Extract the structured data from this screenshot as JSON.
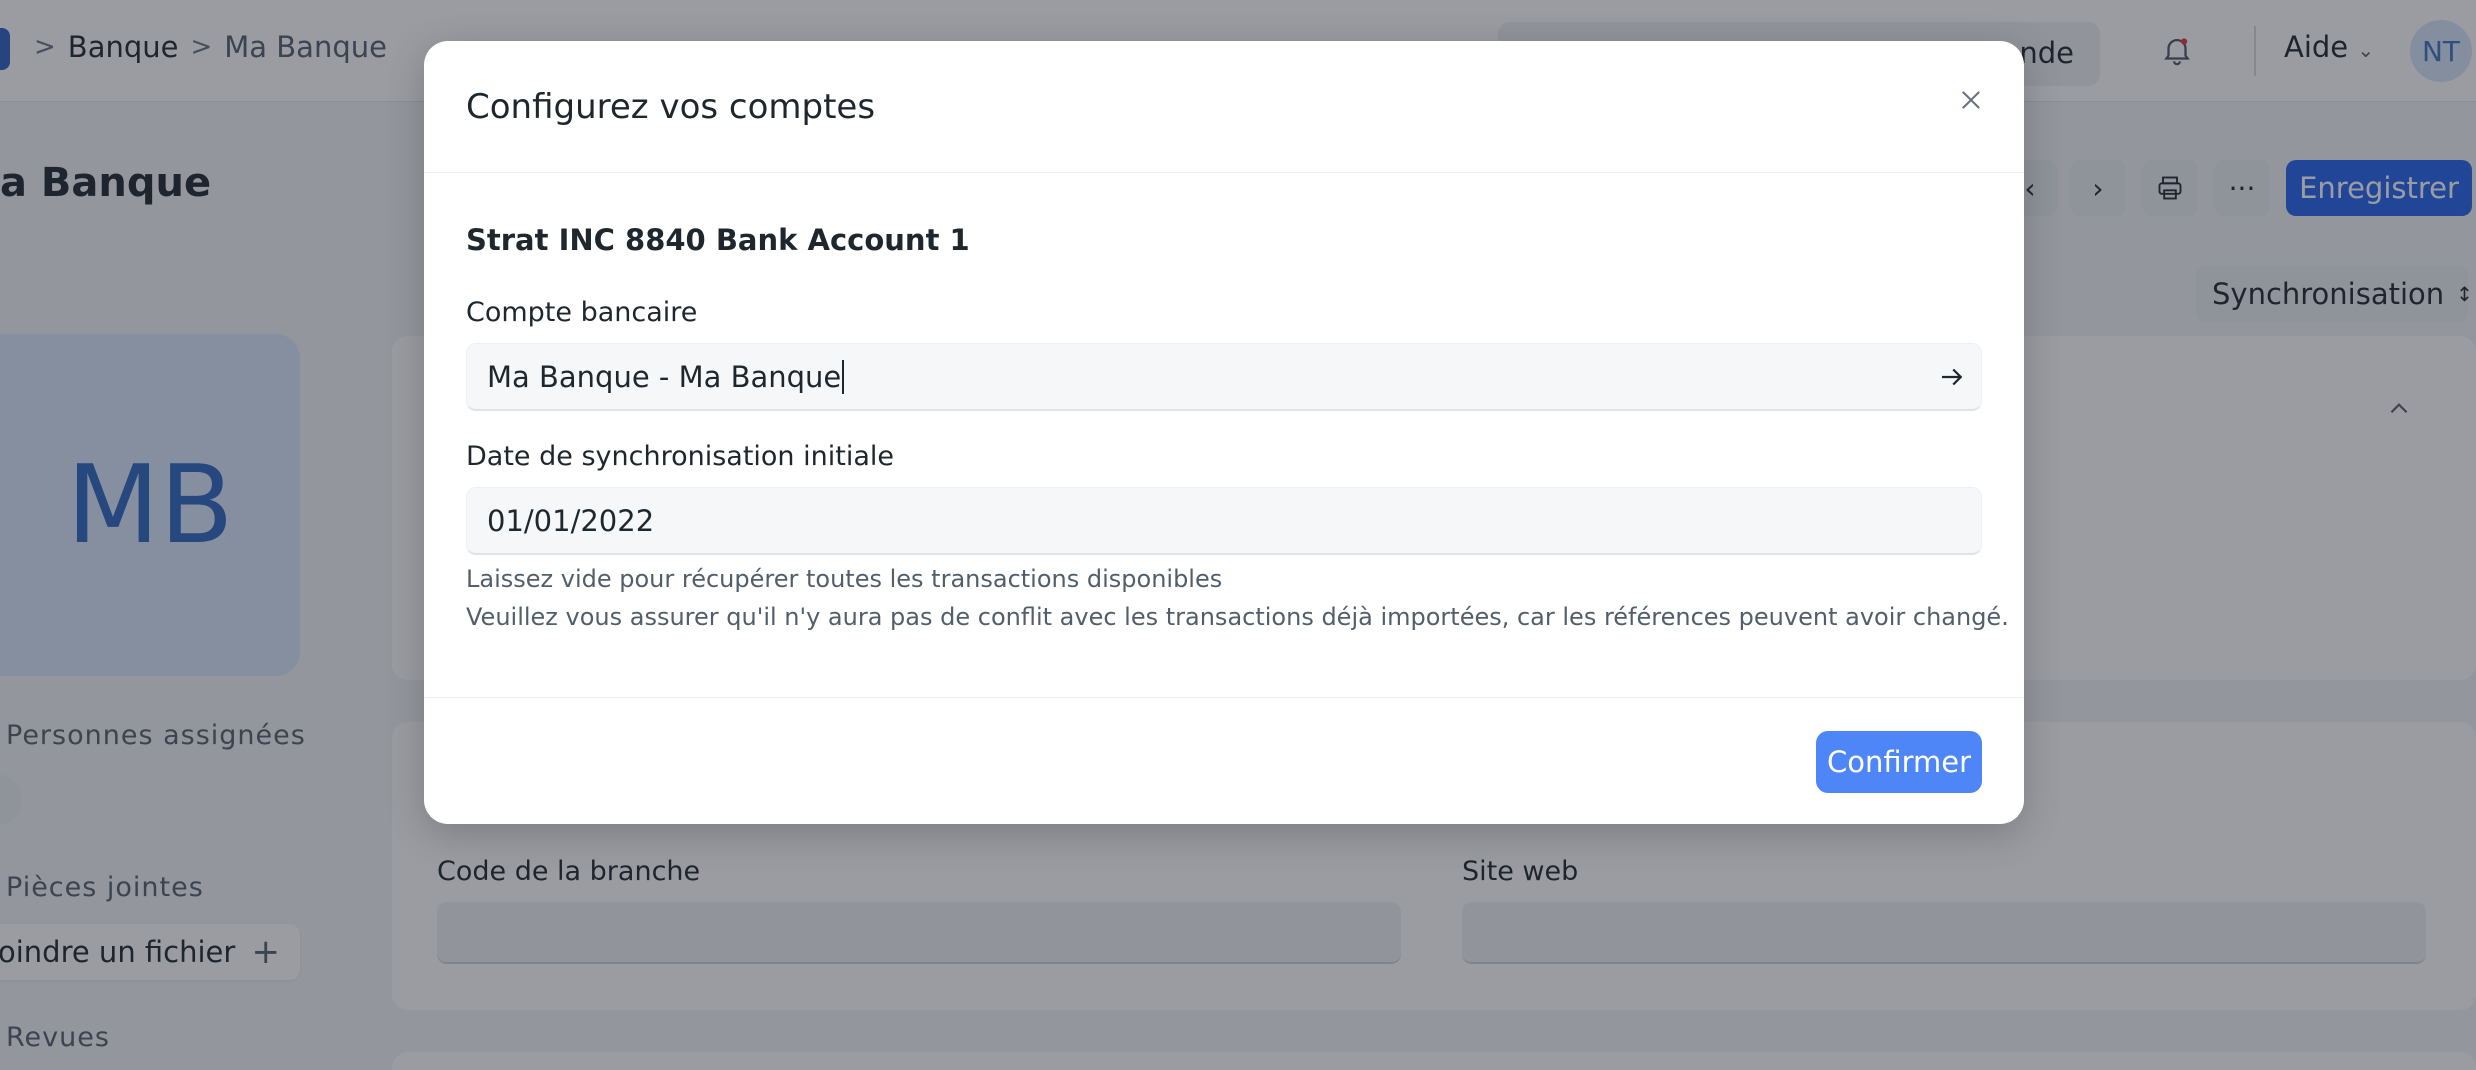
{
  "topbar": {
    "breadcrumb": [
      ">",
      "Banque",
      ">",
      "Ma Banque"
    ],
    "search_tail": "nde",
    "help_label": "Aide",
    "user_initials": "NT"
  },
  "page": {
    "title": "a Banque",
    "save_label": "Enregistrer",
    "more_label": "···",
    "sync_select_value": "Synchronisation",
    "avatar_initials": "MB",
    "assigned_label": "Personnes assignées",
    "attachments_label": "Pièces jointes",
    "attach_button_label": "oindre un fichier",
    "reviews_label": "Revues",
    "branch_code_label": "Code de la branche",
    "website_label": "Site web"
  },
  "modal": {
    "title": "Configurez vos comptes",
    "account_name": "Strat INC 8840 Bank Account 1",
    "bank_account_label": "Compte bancaire",
    "bank_account_value": "Ma Banque - Ma Banque",
    "sync_date_label": "Date de synchronisation initiale",
    "sync_date_value": "01/01/2022",
    "help_line_1": "Laissez vide pour récupérer toutes les transactions disponibles",
    "help_line_2": "Veuillez vous assurer qu'il n'y aura pas de conflit avec les transactions déjà importées, car les références peuvent avoir changé.",
    "confirm_label": "Confirmer"
  },
  "colors": {
    "primary": "#2563eb",
    "confirm": "#4f86f7",
    "overlay": "rgba(30,36,48,0.45)"
  }
}
